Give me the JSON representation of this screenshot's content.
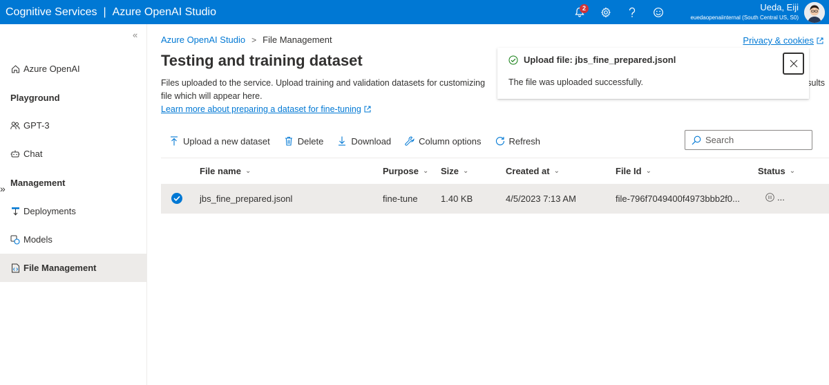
{
  "topbar": {
    "brand1": "Cognitive Services",
    "separator": "|",
    "brand2": "Azure OpenAI Studio",
    "notification_count": "2",
    "icons": [
      "bell-icon",
      "gear-icon",
      "help-icon",
      "feedback-smiley-icon"
    ],
    "user_name": "Ueda, Eiji",
    "user_tenant": "euedaopenaiinternal (South Central US, S0)"
  },
  "sidebar": {
    "collapse": "«",
    "expand": "»",
    "home": "Azure OpenAI",
    "playground_heading": "Playground",
    "gpt3": "GPT-3",
    "chat": "Chat",
    "management_heading": "Management",
    "deployments": "Deployments",
    "models": "Models",
    "file_management": "File Management"
  },
  "breadcrumb": {
    "root": "Azure OpenAI Studio",
    "separator": ">",
    "current": "File Management"
  },
  "privacy": "Privacy & cookies",
  "page": {
    "title": "Testing and training dataset",
    "description_line1": "Files uploaded to the service. Upload training and validation datasets for customizing",
    "description_line1_tail": "sults",
    "description_line2": "file which will appear here.",
    "learn_more": "Learn more about preparing a dataset for fine-tuning"
  },
  "toolbar": {
    "upload": "Upload a new dataset",
    "delete": "Delete",
    "download": "Download",
    "column_options": "Column options",
    "refresh": "Refresh",
    "search_placeholder": "Search"
  },
  "table": {
    "columns": [
      "File name",
      "Purpose",
      "Size",
      "Created at",
      "File Id",
      "Status"
    ],
    "rows": [
      {
        "file_name": "jbs_fine_prepared.jsonl",
        "purpose": "fine-tune",
        "size": "1.40 KB",
        "created_at": "4/5/2023 7:13 AM",
        "file_id": "file-796f7049400f4973bbb2f0...",
        "status": "..."
      }
    ]
  },
  "toast": {
    "title": "Upload file: jbs_fine_prepared.jsonl",
    "message": "The file was uploaded successfully."
  },
  "colors": {
    "brand_blue": "#0078d4",
    "selected_row": "#edebe9",
    "badge_red": "#d13438"
  }
}
